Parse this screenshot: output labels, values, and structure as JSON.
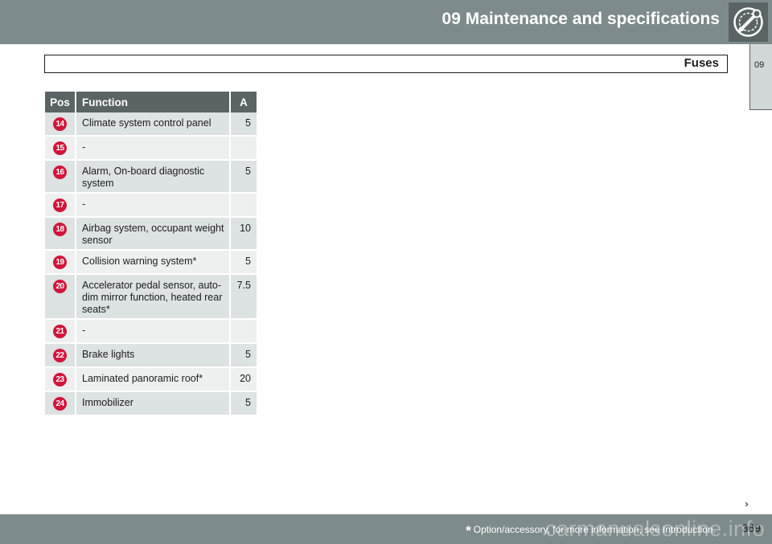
{
  "header": {
    "chapter_title": "09 Maintenance and specifications",
    "chapter_icon": "wrench-gear-icon"
  },
  "section": {
    "title": "Fuses"
  },
  "side_tab": {
    "label": "09"
  },
  "table": {
    "columns": [
      "Pos",
      "Function",
      "A"
    ],
    "rows": [
      {
        "pos": "14",
        "function": "Climate system control panel",
        "amps": "5"
      },
      {
        "pos": "15",
        "function": "-",
        "amps": ""
      },
      {
        "pos": "16",
        "function": "Alarm, On-board diagnostic system",
        "amps": "5"
      },
      {
        "pos": "17",
        "function": "-",
        "amps": ""
      },
      {
        "pos": "18",
        "function": "Airbag system, occupant weight sensor",
        "amps": "10"
      },
      {
        "pos": "19",
        "function": "Collision warning system*",
        "amps": "5"
      },
      {
        "pos": "20",
        "function": "Accelerator pedal sensor, auto-dim mirror function, heated rear seats*",
        "amps": "7.5"
      },
      {
        "pos": "21",
        "function": "-",
        "amps": ""
      },
      {
        "pos": "22",
        "function": "Brake lights",
        "amps": "5"
      },
      {
        "pos": "23",
        "function": "Laminated panoramic roof*",
        "amps": "20"
      },
      {
        "pos": "24",
        "function": "Immobilizer",
        "amps": "5"
      }
    ]
  },
  "navigation": {
    "next_icon": "double-chevron-right-icon",
    "next_symbol": "››"
  },
  "footer": {
    "star": "*",
    "footnote": "Option/accessory, for more information, see Introduction.",
    "page_number": "369",
    "watermark": "carmanualsonline.info"
  },
  "colors": {
    "header_bar": "#7d8b8c",
    "table_header": "#5a6465",
    "row_odd": "#dde2e2",
    "row_even": "#eef0f0",
    "position_marker": "#d2143c"
  }
}
